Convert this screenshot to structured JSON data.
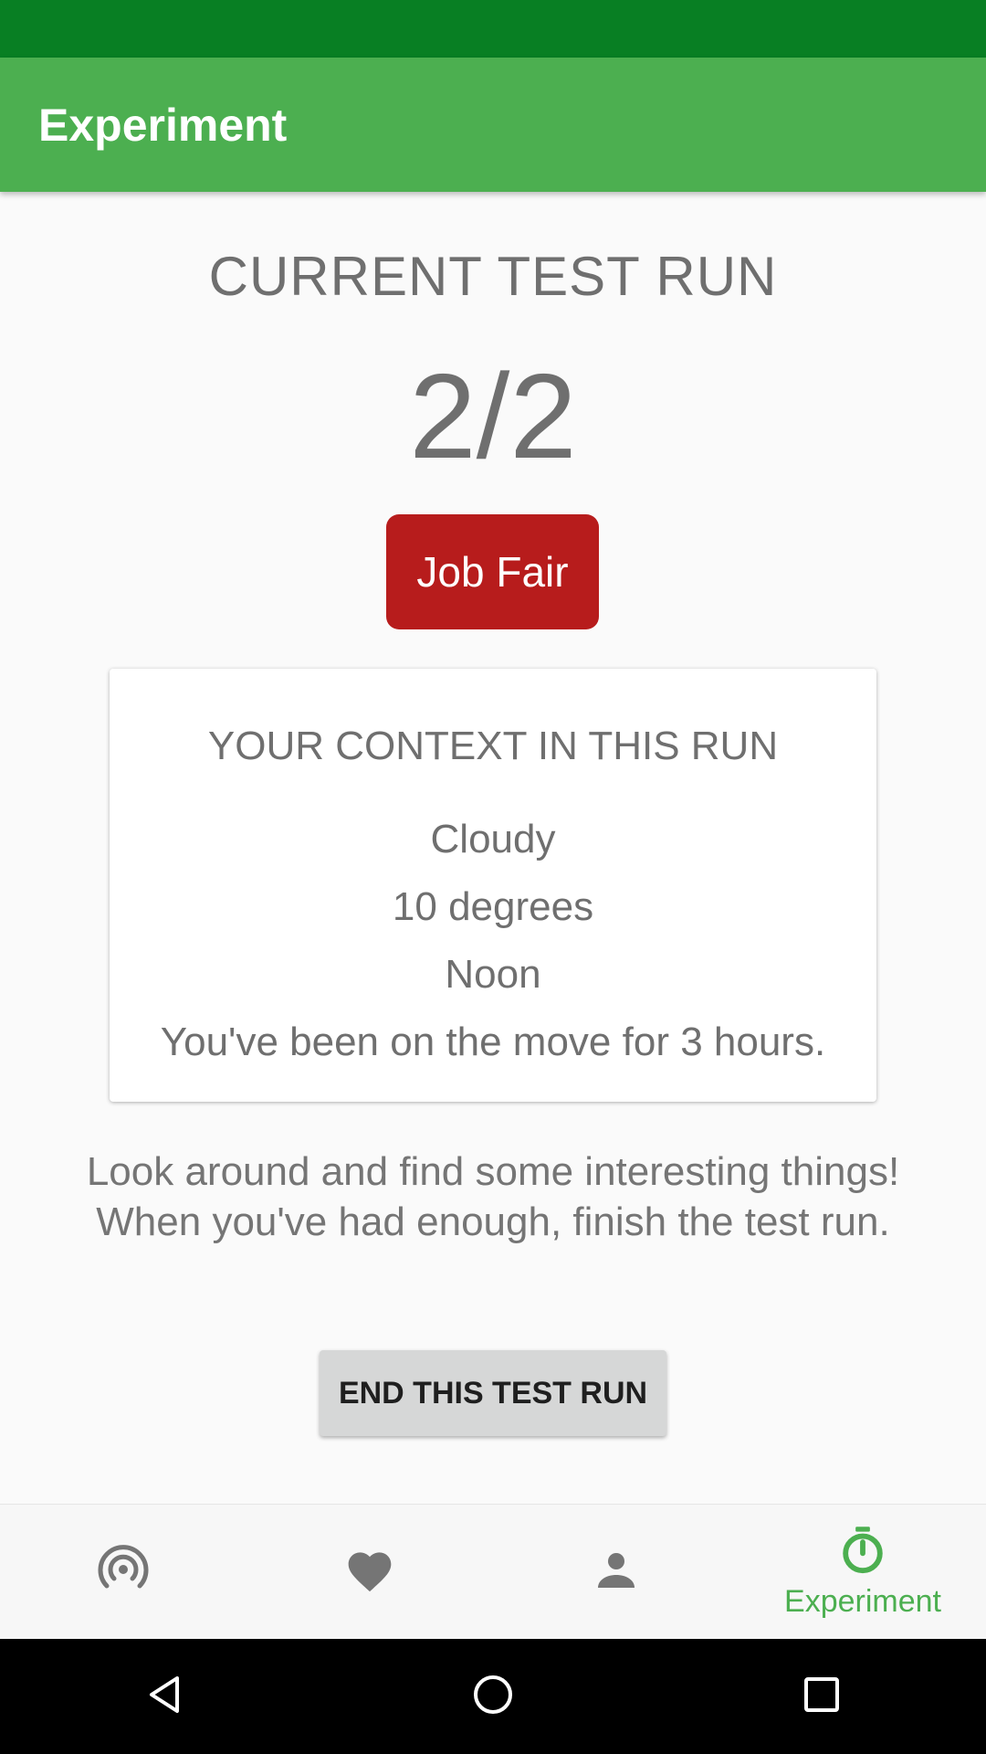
{
  "app_bar": {
    "title": "Experiment"
  },
  "main": {
    "heading": "CURRENT TEST RUN",
    "run_counter": "2/2",
    "tag_button_label": "Job Fair",
    "tag_color": "#b71c1c",
    "context_card": {
      "title": "YOUR CONTEXT IN THIS RUN",
      "lines": [
        "Cloudy",
        "10 degrees",
        "Noon",
        "You've been on the move for 3 hours."
      ]
    },
    "instructions": "Look around and find some interesting things! When you've had enough, finish the test run.",
    "end_button_label": "END THIS TEST RUN"
  },
  "bottom_nav": {
    "items": [
      {
        "icon": "radar-icon",
        "label": "",
        "active": false
      },
      {
        "icon": "heart-icon",
        "label": "",
        "active": false
      },
      {
        "icon": "person-icon",
        "label": "",
        "active": false
      },
      {
        "icon": "stopwatch-icon",
        "label": "Experiment",
        "active": true
      }
    ]
  },
  "colors": {
    "status_bar": "#087f23",
    "primary": "#4caf50",
    "nav_inactive": "#757575"
  },
  "system_nav": {
    "icons": [
      "back-icon",
      "home-icon",
      "recents-icon"
    ]
  }
}
